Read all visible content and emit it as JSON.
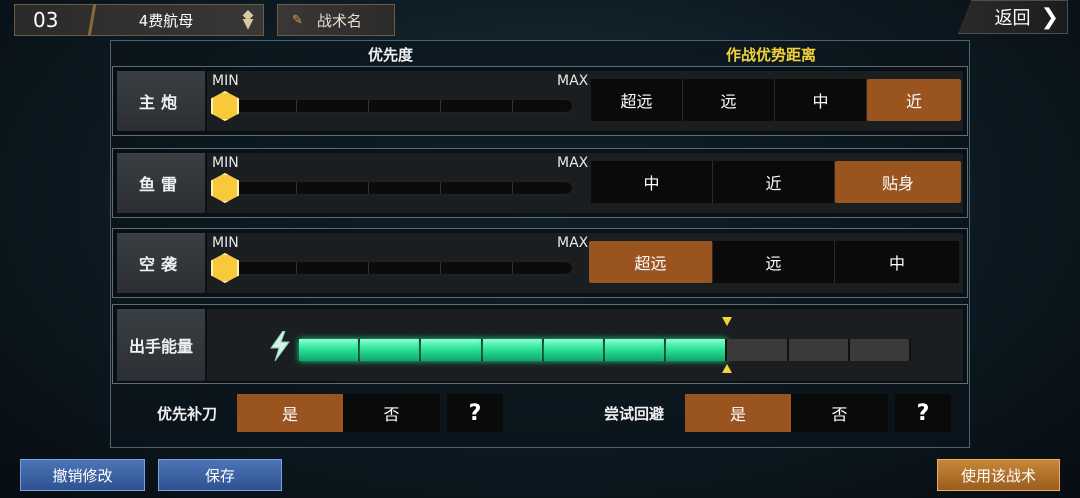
{
  "top_bar": {
    "slot_number": "03",
    "fleet_name": "4费航母",
    "tactic_name": "战术名",
    "back_label": "返回"
  },
  "headers": {
    "priority": "优先度",
    "combat_distance": "作战优势距离"
  },
  "weapons": [
    {
      "label": "主炮",
      "min_label": "MIN",
      "max_label": "MAX",
      "priority_value": 0,
      "distances": [
        {
          "label": "超远",
          "selected": false
        },
        {
          "label": "远",
          "selected": false
        },
        {
          "label": "中",
          "selected": false
        },
        {
          "label": "近",
          "selected": true
        }
      ]
    },
    {
      "label": "鱼雷",
      "min_label": "MIN",
      "max_label": "MAX",
      "priority_value": 0,
      "distances": [
        {
          "label": "中",
          "selected": false
        },
        {
          "label": "近",
          "selected": false
        },
        {
          "label": "贴身",
          "selected": true
        }
      ]
    },
    {
      "label": "空袭",
      "min_label": "MIN",
      "max_label": "MAX",
      "priority_value": 0,
      "distances": [
        {
          "label": "超远",
          "selected": true
        },
        {
          "label": "远",
          "selected": false
        },
        {
          "label": "中",
          "selected": false
        }
      ]
    }
  ],
  "energy": {
    "label": "出手能量",
    "total_segments": 10,
    "filled_segments": 7,
    "colors": {
      "filled": "#2de39a",
      "marker": "#f3d23a"
    }
  },
  "toggles": {
    "priority_finish": {
      "label": "优先补刀",
      "yes": "是",
      "no": "否",
      "selected": "yes",
      "help": "?"
    },
    "try_evade": {
      "label": "尝试回避",
      "yes": "是",
      "no": "否",
      "selected": "yes",
      "help": "?"
    }
  },
  "bottom": {
    "undo_label": "撤销修改",
    "save_label": "保存",
    "use_label": "使用该战术"
  },
  "colors": {
    "selected_option": "#9a5420",
    "distance_header": "#f3d23a",
    "primary_blue": "#4b75b8",
    "action_orange": "#c7873a"
  }
}
